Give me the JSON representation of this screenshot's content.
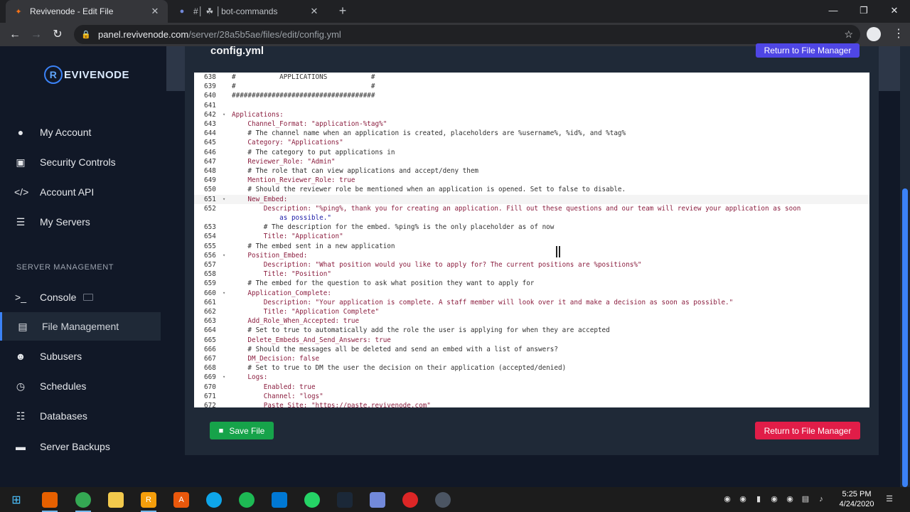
{
  "browser": {
    "tabs": [
      {
        "title": "Revivenode - Edit File",
        "active": true
      },
      {
        "title": "#│ ☘ │bot-commands",
        "active": false
      }
    ],
    "url_host": "panel.revivenode.com",
    "url_path": "/server/28a5b5ae/files/edit/config.yml"
  },
  "sidebar": {
    "brand": "EVIVENODE",
    "brand_mark": "R",
    "account_items": [
      {
        "label": "My Account",
        "icon": "user-icon"
      },
      {
        "label": "Security Controls",
        "icon": "lock-icon"
      },
      {
        "label": "Account API",
        "icon": "code-icon"
      },
      {
        "label": "My Servers",
        "icon": "server-icon"
      }
    ],
    "section_label": "SERVER MANAGEMENT",
    "server_items": [
      {
        "label": "Console",
        "icon": "terminal-icon"
      },
      {
        "label": "File Management",
        "icon": "folder-icon",
        "active": true
      },
      {
        "label": "Subusers",
        "icon": "users-icon"
      },
      {
        "label": "Schedules",
        "icon": "clock-icon"
      },
      {
        "label": "Databases",
        "icon": "database-icon"
      },
      {
        "label": "Server Backups",
        "icon": "hdd-icon"
      }
    ]
  },
  "editor": {
    "file_name": "config.yml",
    "return_label": "Return to File Manager",
    "save_label": "Save File",
    "lines": [
      {
        "n": "638",
        "text": "#           APPLICATIONS           #",
        "kind": "com"
      },
      {
        "n": "639",
        "text": "#                                  #",
        "kind": "com"
      },
      {
        "n": "640",
        "text": "####################################",
        "kind": "com"
      },
      {
        "n": "641",
        "text": "",
        "kind": "com"
      },
      {
        "n": "642",
        "text": "Applications:",
        "kind": "key",
        "fold": true
      },
      {
        "n": "643",
        "text": "    Channel_Format: \"application-%tag%\"",
        "kind": "key"
      },
      {
        "n": "644",
        "text": "    # The channel name when an application is created, placeholders are %username%, %id%, and %tag%",
        "kind": "com"
      },
      {
        "n": "645",
        "text": "    Category: \"Applications\"",
        "kind": "key"
      },
      {
        "n": "646",
        "text": "    # The category to put applications in",
        "kind": "com"
      },
      {
        "n": "647",
        "text": "    Reviewer_Role: \"Admin\"",
        "kind": "key"
      },
      {
        "n": "648",
        "text": "    # The role that can view applications and accept/deny them",
        "kind": "com"
      },
      {
        "n": "649",
        "text": "    Mention_Reviewer_Role: true",
        "kind": "key"
      },
      {
        "n": "650",
        "text": "    # Should the reviewer role be mentioned when an application is opened. Set to false to disable.",
        "kind": "com"
      },
      {
        "n": "651",
        "text": "    New_Embed:",
        "kind": "key",
        "fold": true,
        "current": true
      },
      {
        "n": "652",
        "text": "        Description: \"%ping%, thank you for creating an application. Fill out these questions and our team will review your application as soon",
        "kind": "key"
      },
      {
        "n": "",
        "text": "            as possible.\"",
        "kind": "str"
      },
      {
        "n": "653",
        "text": "        # The description for the embed. %ping% is the only placeholder as of now",
        "kind": "com"
      },
      {
        "n": "654",
        "text": "        Title: \"Application\"",
        "kind": "key"
      },
      {
        "n": "655",
        "text": "    # The embed sent in a new application",
        "kind": "com"
      },
      {
        "n": "656",
        "text": "    Position_Embed:",
        "kind": "key",
        "fold": true
      },
      {
        "n": "657",
        "text": "        Description: \"What position would you like to apply for? The current positions are %positions%\"",
        "kind": "key"
      },
      {
        "n": "658",
        "text": "        Title: \"Position\"",
        "kind": "key"
      },
      {
        "n": "659",
        "text": "    # The embed for the question to ask what position they want to apply for",
        "kind": "com"
      },
      {
        "n": "660",
        "text": "    Application_Complete:",
        "kind": "key",
        "fold": true
      },
      {
        "n": "661",
        "text": "        Description: \"Your application is complete. A staff member will look over it and make a decision as soon as possible.\"",
        "kind": "key"
      },
      {
        "n": "662",
        "text": "        Title: \"Application Complete\"",
        "kind": "key"
      },
      {
        "n": "663",
        "text": "    Add_Role_When_Accepted: true",
        "kind": "key"
      },
      {
        "n": "664",
        "text": "    # Set to true to automatically add the role the user is applying for when they are accepted",
        "kind": "com"
      },
      {
        "n": "665",
        "text": "    Delete_Embeds_And_Send_Answers: true",
        "kind": "key"
      },
      {
        "n": "666",
        "text": "    # Should the messages all be deleted and send an embed with a list of answers?",
        "kind": "com"
      },
      {
        "n": "667",
        "text": "    DM_Decision: false",
        "kind": "key"
      },
      {
        "n": "668",
        "text": "    # Set to true to DM the user the decision on their application (accepted/denied)",
        "kind": "com"
      },
      {
        "n": "669",
        "text": "    Logs:",
        "kind": "key",
        "fold": true
      },
      {
        "n": "670",
        "text": "        Enabled: true",
        "kind": "key"
      },
      {
        "n": "671",
        "text": "        Channel: \"logs\"",
        "kind": "key"
      },
      {
        "n": "672",
        "text": "        Paste_Site: \"https://paste.revivenode.com\"",
        "kind": "key"
      }
    ]
  },
  "taskbar": {
    "time": "5:25 PM",
    "date": "4/24/2020"
  },
  "colors": {
    "accent": "#3b82f6",
    "danger": "#e11d48",
    "success": "#16a34a",
    "indigo": "#4f46e5"
  }
}
